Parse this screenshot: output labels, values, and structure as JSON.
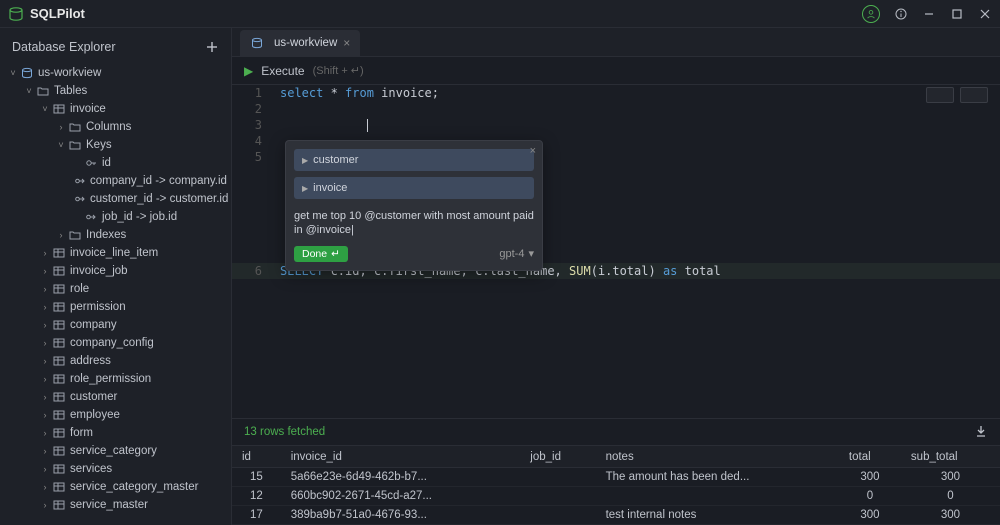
{
  "app_name": "SQLPilot",
  "sidebar": {
    "title": "Database Explorer",
    "connection": "us-workview",
    "tables_label": "Tables",
    "invoice": {
      "name": "invoice",
      "columns_label": "Columns",
      "keys_label": "Keys",
      "keys": {
        "pk": "id",
        "fk1": "company_id -> company.id",
        "fk2": "customer_id -> customer.id",
        "fk3": "job_id -> job.id"
      },
      "indexes_label": "Indexes"
    },
    "other_tables": [
      "invoice_line_item",
      "invoice_job",
      "role",
      "permission",
      "company",
      "company_config",
      "address",
      "role_permission",
      "customer",
      "employee",
      "form",
      "service_category",
      "services",
      "service_category_master",
      "service_master"
    ]
  },
  "tab": {
    "label": "us-workview"
  },
  "toolbar": {
    "execute": "Execute",
    "hint": "(Shift + ↵)"
  },
  "code": {
    "l1_kw1": "select",
    "l1_mid": " * ",
    "l1_kw2": "from",
    "l1_rest": " invoice;",
    "l6_kw": "SELECT",
    "l6_mid": " c.id, c.first_name, c.last_name, ",
    "l6_func": "SUM",
    "l6_paren": "(i.total) ",
    "l6_as": "as",
    "l6_total": " total"
  },
  "ai": {
    "chip1": "customer",
    "chip2": "invoice",
    "prompt": "get me top 10 @customer with most amount paid in @invoice|",
    "done": "Done",
    "model": "gpt-4"
  },
  "results": {
    "status": "13 rows fetched",
    "cols": {
      "c0": "id",
      "c1": "invoice_id",
      "c2": "job_id",
      "c3": "notes",
      "c4": "total",
      "c5": "sub_total"
    },
    "rows": [
      {
        "id": "15",
        "invoice_id": "5a66e23e-6d49-462b-b7...",
        "job_id": "",
        "notes": "The amount has been ded...",
        "total": "300",
        "sub_total": "300"
      },
      {
        "id": "12",
        "invoice_id": "660bc902-2671-45cd-a27...",
        "job_id": "",
        "notes": "",
        "total": "0",
        "sub_total": "0"
      },
      {
        "id": "17",
        "invoice_id": "389ba9b7-51a0-4676-93...",
        "job_id": "",
        "notes": "test internal notes",
        "total": "300",
        "sub_total": "300"
      }
    ]
  }
}
